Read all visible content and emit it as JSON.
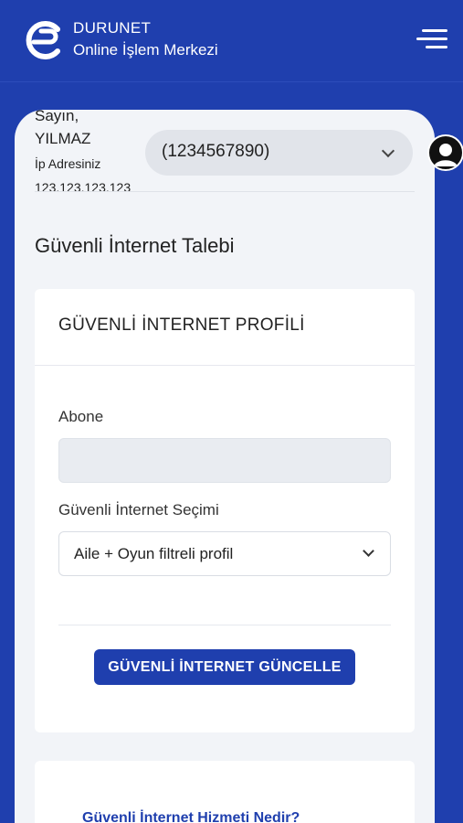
{
  "header": {
    "brand_name": "DURUNET",
    "brand_sub": "Online İşlem Merkezi"
  },
  "user": {
    "greeting": "Sayın,",
    "name": "YILMAZ",
    "ip_label": "İp Adresiniz",
    "ip_value": "123.123.123.123"
  },
  "account_select": {
    "value": "(1234567890)"
  },
  "page": {
    "title": "Güvenli İnternet Talebi"
  },
  "form": {
    "panel_title": "GÜVENLİ İNTERNET PROFİLİ",
    "abone_label": "Abone",
    "abone_value": "",
    "selection_label": "Güvenli İnternet Seçimi",
    "selection_value": "Aile + Oyun filtreli profil",
    "submit_label": "GÜVENLİ İNTERNET GÜNCELLE"
  },
  "info": {
    "link_label": "Güvenli İnternet Hizmeti Nedir?"
  },
  "icons": [
    "logo-icon",
    "menu-icon",
    "user-avatar-icon",
    "chevron-down-icon"
  ],
  "colors": {
    "primary": "#1f3fae",
    "background": "#f2f4f8"
  }
}
